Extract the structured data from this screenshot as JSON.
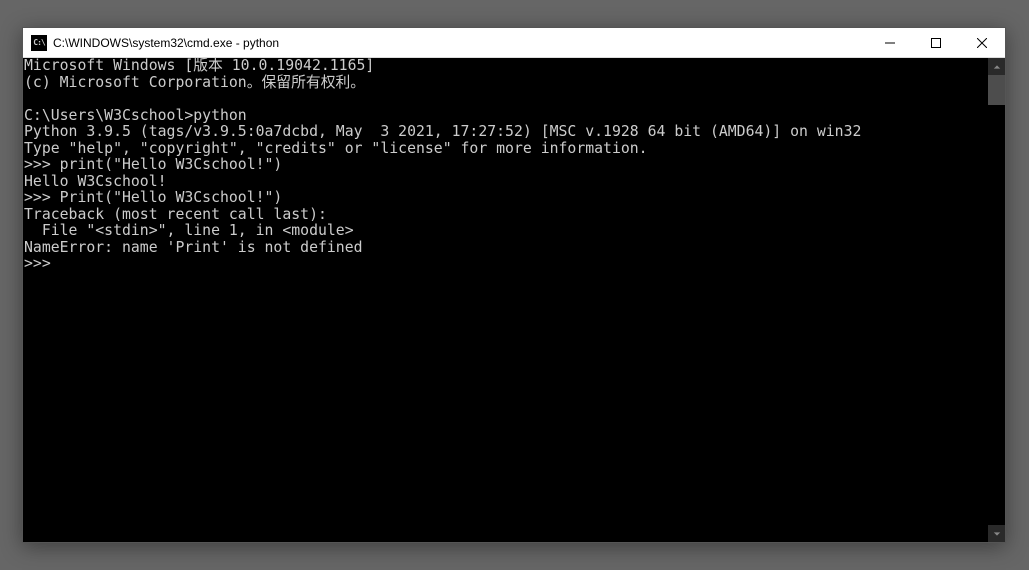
{
  "titlebar": {
    "icon_text": "C:\\",
    "title": "C:\\WINDOWS\\system32\\cmd.exe - python"
  },
  "console": {
    "lines": [
      "Microsoft Windows [版本 10.0.19042.1165]",
      "(c) Microsoft Corporation。保留所有权利。",
      "",
      "C:\\Users\\W3Cschool>python",
      "Python 3.9.5 (tags/v3.9.5:0a7dcbd, May  3 2021, 17:27:52) [MSC v.1928 64 bit (AMD64)] on win32",
      "Type \"help\", \"copyright\", \"credits\" or \"license\" for more information.",
      ">>> print(\"Hello W3Cschool!\")",
      "Hello W3Cschool!",
      ">>> Print(\"Hello W3Cschool!\")",
      "Traceback (most recent call last):",
      "  File \"<stdin>\", line 1, in <module>",
      "NameError: name 'Print' is not defined",
      ">>>"
    ]
  }
}
